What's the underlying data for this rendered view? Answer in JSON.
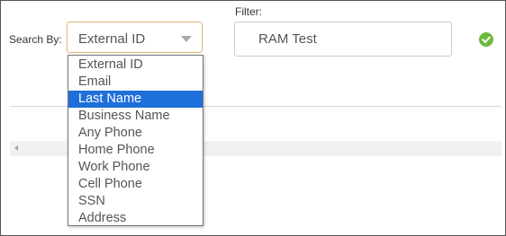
{
  "search_by": {
    "label": "Search By:",
    "selected_value": "External ID",
    "options": [
      {
        "label": "External ID",
        "highlighted": false
      },
      {
        "label": "Email",
        "highlighted": false
      },
      {
        "label": "Last Name",
        "highlighted": true
      },
      {
        "label": "Business Name",
        "highlighted": false
      },
      {
        "label": "Any Phone",
        "highlighted": false
      },
      {
        "label": "Home Phone",
        "highlighted": false
      },
      {
        "label": "Work Phone",
        "highlighted": false
      },
      {
        "label": "Cell Phone",
        "highlighted": false
      },
      {
        "label": "SSN",
        "highlighted": false
      },
      {
        "label": "Address",
        "highlighted": false
      }
    ]
  },
  "filter": {
    "label": "Filter:",
    "value": "RAM Test"
  },
  "status_icon": "check-circle-icon",
  "colors": {
    "highlight": "#1e6fd9",
    "select_border": "#e4b173",
    "check": "#6cbb3c"
  }
}
